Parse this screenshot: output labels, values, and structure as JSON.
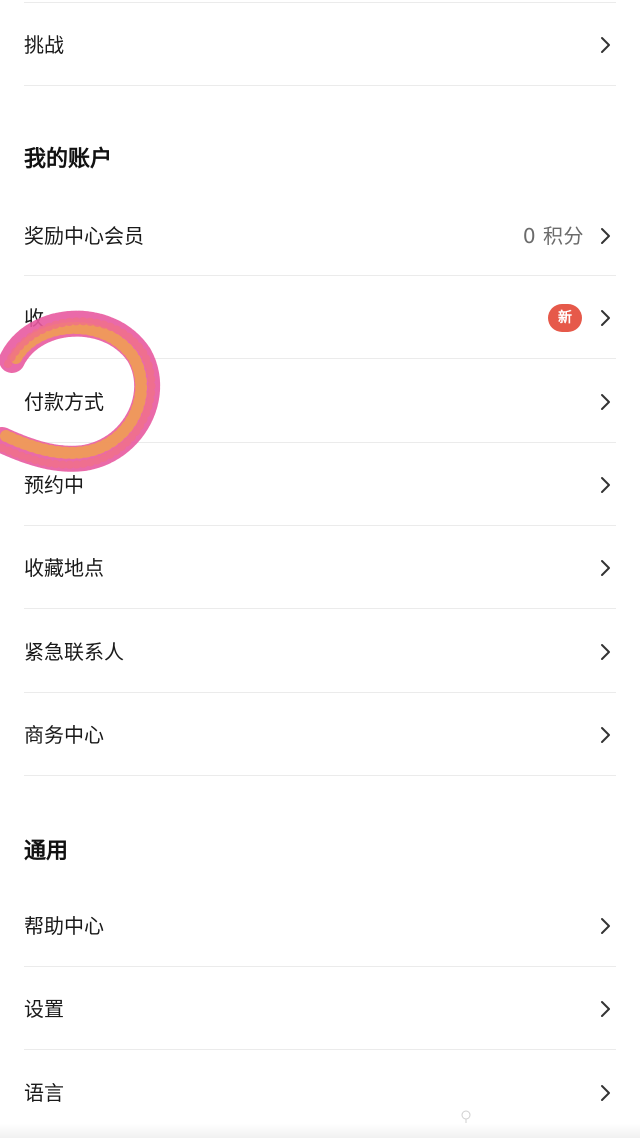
{
  "rows": {
    "challenge": {
      "label": "挑战"
    },
    "rewards": {
      "label": "奖励中心会员",
      "value": "0 积分"
    },
    "hidden_item": {
      "label": "收",
      "badge": "新"
    },
    "payment": {
      "label": "付款方式"
    },
    "reservations": {
      "label": "预约中"
    },
    "saved_places": {
      "label": "收藏地点"
    },
    "emergency_contacts": {
      "label": "紧急联系人"
    },
    "business_center": {
      "label": "商务中心"
    },
    "help_center": {
      "label": "帮助中心"
    },
    "settings": {
      "label": "设置"
    },
    "language": {
      "label": "语言"
    }
  },
  "sections": {
    "my_account": "我的账户",
    "general": "通用"
  },
  "colors": {
    "badge": "#e6594a",
    "chevron": "#333333",
    "divider": "#ebebeb",
    "scribble_pink": "#e85aa0",
    "scribble_orange": "#f0a050"
  },
  "icons": {
    "chevron": "chevron-right-icon"
  }
}
